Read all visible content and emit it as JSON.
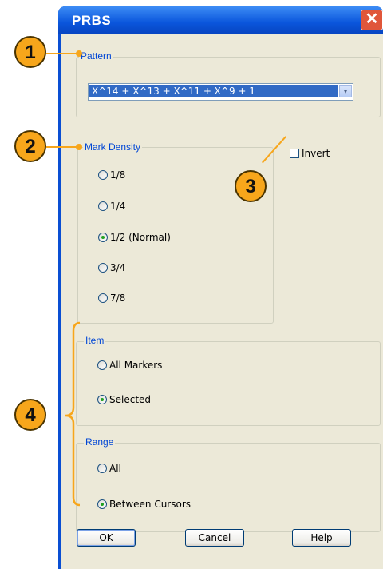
{
  "dialog": {
    "title": "PRBS",
    "close_glyph": "✕"
  },
  "pattern": {
    "group_label": "Pattern",
    "value": "X^14 + X^13 + X^11 + X^9 + 1",
    "dropdown_glyph": "▾"
  },
  "mark_density": {
    "group_label": "Mark Density",
    "options": [
      {
        "label": "1/8",
        "selected": false
      },
      {
        "label": "1/4",
        "selected": false
      },
      {
        "label": "1/2 (Normal)",
        "selected": true
      },
      {
        "label": "3/4",
        "selected": false
      },
      {
        "label": "7/8",
        "selected": false
      }
    ]
  },
  "invert": {
    "label": "Invert",
    "checked": false
  },
  "item": {
    "group_label": "Item",
    "options": [
      {
        "label": "All Markers",
        "selected": false
      },
      {
        "label": "Selected",
        "selected": true
      }
    ]
  },
  "range": {
    "group_label": "Range",
    "options": [
      {
        "label": "All",
        "selected": false
      },
      {
        "label": "Between Cursors",
        "selected": true
      }
    ]
  },
  "buttons": {
    "ok": "OK",
    "cancel": "Cancel",
    "help": "Help"
  },
  "callouts": [
    "1",
    "2",
    "3",
    "4"
  ],
  "colors": {
    "title_bar": "#0a56dc",
    "callout": "#f7a61b",
    "group_label": "#0046d5"
  }
}
